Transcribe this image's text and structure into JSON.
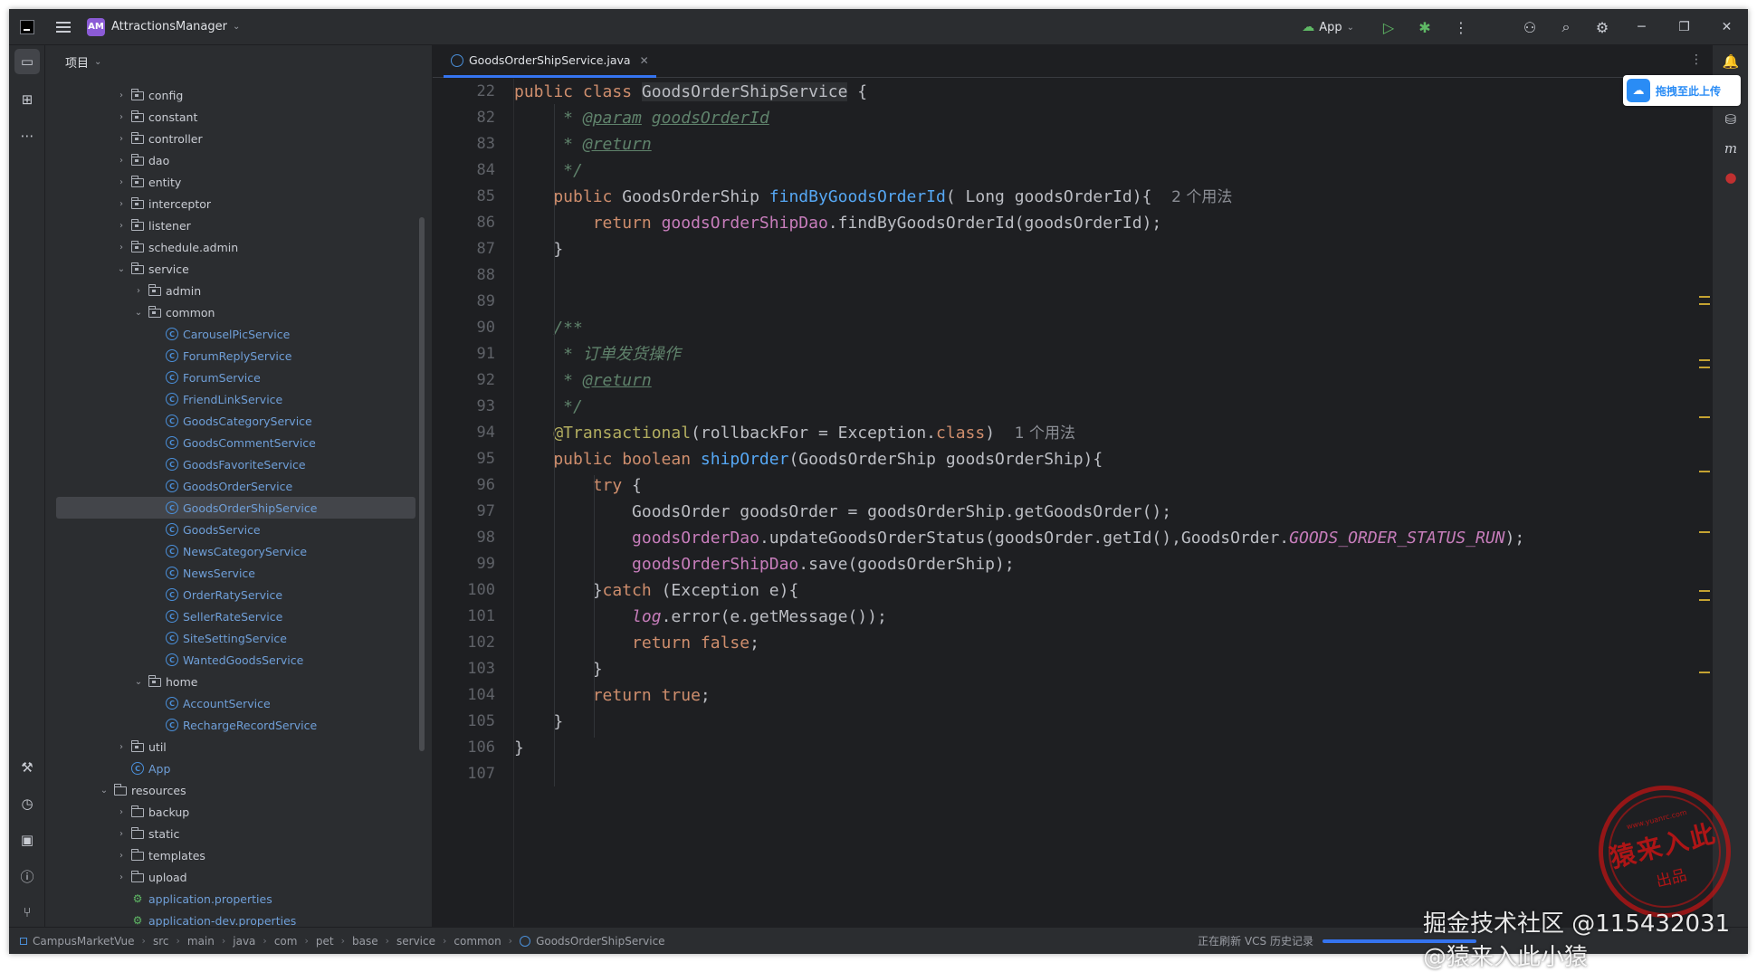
{
  "titlebar": {
    "project_initials": "AM",
    "project_name": "AttractionsManager",
    "run_config": "App"
  },
  "project_panel": {
    "title": "项目",
    "tree": [
      {
        "label": "config",
        "depth": 1,
        "kind": "folder",
        "expanded": false
      },
      {
        "label": "constant",
        "depth": 1,
        "kind": "folder",
        "expanded": false
      },
      {
        "label": "controller",
        "depth": 1,
        "kind": "folder",
        "expanded": false
      },
      {
        "label": "dao",
        "depth": 1,
        "kind": "folder",
        "expanded": false
      },
      {
        "label": "entity",
        "depth": 1,
        "kind": "folder",
        "expanded": false
      },
      {
        "label": "interceptor",
        "depth": 1,
        "kind": "folder",
        "expanded": false
      },
      {
        "label": "listener",
        "depth": 1,
        "kind": "folder",
        "expanded": false
      },
      {
        "label": "schedule.admin",
        "depth": 1,
        "kind": "folder",
        "expanded": false
      },
      {
        "label": "service",
        "depth": 1,
        "kind": "folder",
        "expanded": true
      },
      {
        "label": "admin",
        "depth": 2,
        "kind": "folder",
        "expanded": false
      },
      {
        "label": "common",
        "depth": 2,
        "kind": "folder",
        "expanded": true
      },
      {
        "label": "CarouselPicService",
        "depth": 3,
        "kind": "class"
      },
      {
        "label": "ForumReplyService",
        "depth": 3,
        "kind": "class"
      },
      {
        "label": "ForumService",
        "depth": 3,
        "kind": "class"
      },
      {
        "label": "FriendLinkService",
        "depth": 3,
        "kind": "class"
      },
      {
        "label": "GoodsCategoryService",
        "depth": 3,
        "kind": "class"
      },
      {
        "label": "GoodsCommentService",
        "depth": 3,
        "kind": "class"
      },
      {
        "label": "GoodsFavoriteService",
        "depth": 3,
        "kind": "class"
      },
      {
        "label": "GoodsOrderService",
        "depth": 3,
        "kind": "class"
      },
      {
        "label": "GoodsOrderShipService",
        "depth": 3,
        "kind": "class",
        "selected": true
      },
      {
        "label": "GoodsService",
        "depth": 3,
        "kind": "class"
      },
      {
        "label": "NewsCategoryService",
        "depth": 3,
        "kind": "class"
      },
      {
        "label": "NewsService",
        "depth": 3,
        "kind": "class"
      },
      {
        "label": "OrderRatyService",
        "depth": 3,
        "kind": "class"
      },
      {
        "label": "SellerRateService",
        "depth": 3,
        "kind": "class"
      },
      {
        "label": "SiteSettingService",
        "depth": 3,
        "kind": "class"
      },
      {
        "label": "WantedGoodsService",
        "depth": 3,
        "kind": "class"
      },
      {
        "label": "home",
        "depth": 2,
        "kind": "folder",
        "expanded": true
      },
      {
        "label": "AccountService",
        "depth": 3,
        "kind": "class"
      },
      {
        "label": "RechargeRecordService",
        "depth": 3,
        "kind": "class"
      },
      {
        "label": "util",
        "depth": 1,
        "kind": "folder",
        "expanded": false
      },
      {
        "label": "App",
        "depth": 1,
        "kind": "class"
      },
      {
        "label": "resources",
        "depth": 0,
        "kind": "folder",
        "expanded": true
      },
      {
        "label": "backup",
        "depth": 1,
        "kind": "folder",
        "expanded": false
      },
      {
        "label": "static",
        "depth": 1,
        "kind": "folder",
        "expanded": false
      },
      {
        "label": "templates",
        "depth": 1,
        "kind": "folder",
        "expanded": false
      },
      {
        "label": "upload",
        "depth": 1,
        "kind": "folder",
        "expanded": false
      },
      {
        "label": "application.properties",
        "depth": 1,
        "kind": "properties"
      },
      {
        "label": "application-dev.properties",
        "depth": 1,
        "kind": "properties"
      }
    ]
  },
  "editor": {
    "tab_label": "GoodsOrderShipService.java",
    "upload_label": "拖拽至此上传",
    "lines": [
      {
        "no": "22",
        "parts": [
          [
            "kw",
            "public class "
          ],
          [
            "plain hl",
            "GoodsOrderShipService"
          ],
          [
            "plain",
            " {"
          ]
        ]
      },
      {
        "no": "82",
        "parts": [
          [
            "cm",
            "     * "
          ],
          [
            "tag",
            "@param"
          ],
          [
            "cm",
            " "
          ],
          [
            "tag",
            "goodsOrderId"
          ]
        ]
      },
      {
        "no": "83",
        "parts": [
          [
            "cm",
            "     * "
          ],
          [
            "tag",
            "@return"
          ]
        ]
      },
      {
        "no": "84",
        "parts": [
          [
            "cm",
            "     */"
          ]
        ]
      },
      {
        "no": "85",
        "parts": [
          [
            "kw",
            "    public "
          ],
          [
            "plain",
            "GoodsOrderShip "
          ],
          [
            "fn",
            "findByGoodsOrderId"
          ],
          [
            "plain",
            "( Long goodsOrderId){  "
          ],
          [
            "hint",
            "2 个用法"
          ]
        ]
      },
      {
        "no": "86",
        "parts": [
          [
            "kw",
            "        return "
          ],
          [
            "fld",
            "goodsOrderShipDao"
          ],
          [
            "plain",
            ".findByGoodsOrderId(goodsOrderId);"
          ]
        ]
      },
      {
        "no": "87",
        "parts": [
          [
            "plain",
            "    }"
          ]
        ]
      },
      {
        "no": "88",
        "parts": []
      },
      {
        "no": "89",
        "parts": []
      },
      {
        "no": "90",
        "parts": [
          [
            "cm",
            "    /**"
          ]
        ]
      },
      {
        "no": "91",
        "parts": [
          [
            "cm",
            "     * 订单发货操作"
          ]
        ]
      },
      {
        "no": "92",
        "parts": [
          [
            "cm",
            "     * "
          ],
          [
            "tag",
            "@return"
          ]
        ]
      },
      {
        "no": "93",
        "parts": [
          [
            "cm",
            "     */"
          ]
        ]
      },
      {
        "no": "94",
        "parts": [
          [
            "ann",
            "    @Transactional"
          ],
          [
            "plain",
            "(rollbackFor = Exception."
          ],
          [
            "kw",
            "class"
          ],
          [
            "plain",
            ")  "
          ],
          [
            "hint",
            "1 个用法"
          ]
        ]
      },
      {
        "no": "95",
        "parts": [
          [
            "kw",
            "    public boolean "
          ],
          [
            "fn",
            "shipOrder"
          ],
          [
            "plain",
            "(GoodsOrderShip goodsOrderShip){"
          ]
        ]
      },
      {
        "no": "96",
        "parts": [
          [
            "kw",
            "        try "
          ],
          [
            "plain",
            "{"
          ]
        ]
      },
      {
        "no": "97",
        "parts": [
          [
            "plain",
            "            GoodsOrder goodsOrder = goodsOrderShip.getGoodsOrder();"
          ]
        ]
      },
      {
        "no": "98",
        "parts": [
          [
            "fld",
            "            goodsOrderDao"
          ],
          [
            "plain",
            ".updateGoodsOrderStatus(goodsOrder.getId(),GoodsOrder."
          ],
          [
            "fldi",
            "GOODS_ORDER_STATUS_RUN"
          ],
          [
            "plain",
            ");"
          ]
        ]
      },
      {
        "no": "99",
        "parts": [
          [
            "fld",
            "            goodsOrderShipDao"
          ],
          [
            "plain",
            ".save(goodsOrderShip);"
          ]
        ]
      },
      {
        "no": "100",
        "parts": [
          [
            "plain",
            "        }"
          ],
          [
            "kw",
            "catch "
          ],
          [
            "plain",
            "(Exception e){"
          ]
        ]
      },
      {
        "no": "101",
        "parts": [
          [
            "logi",
            "            log"
          ],
          [
            "plain",
            ".error(e.getMessage());"
          ]
        ]
      },
      {
        "no": "102",
        "parts": [
          [
            "kw",
            "            return false"
          ],
          [
            "plain",
            ";"
          ]
        ]
      },
      {
        "no": "103",
        "parts": [
          [
            "plain",
            "        }"
          ]
        ]
      },
      {
        "no": "104",
        "parts": [
          [
            "kw",
            "        return true"
          ],
          [
            "plain",
            ";"
          ]
        ]
      },
      {
        "no": "105",
        "parts": [
          [
            "plain",
            "    }"
          ]
        ]
      },
      {
        "no": "106",
        "parts": [
          [
            "plain",
            "}"
          ]
        ]
      },
      {
        "no": "107",
        "parts": []
      }
    ]
  },
  "statusbar": {
    "breadcrumb": [
      "CampusMarketVue",
      "src",
      "main",
      "java",
      "com",
      "pet",
      "base",
      "service",
      "common",
      "GoodsOrderShipService"
    ],
    "status_text": "正在刷新 VCS 历史记录"
  },
  "watermarks": {
    "stamp_top": "www.yuanrc.com",
    "stamp_main": "猿来入此",
    "stamp_sub": "出品",
    "csdn": "掘金技术社区 @115432031 @猿来入此小猿"
  },
  "colors": {
    "accent": "#3574f0",
    "keyword": "#cf8e6d",
    "function": "#56a8f5",
    "field": "#c77dbb",
    "comment": "#5f826b",
    "annotation": "#b3ae60"
  }
}
